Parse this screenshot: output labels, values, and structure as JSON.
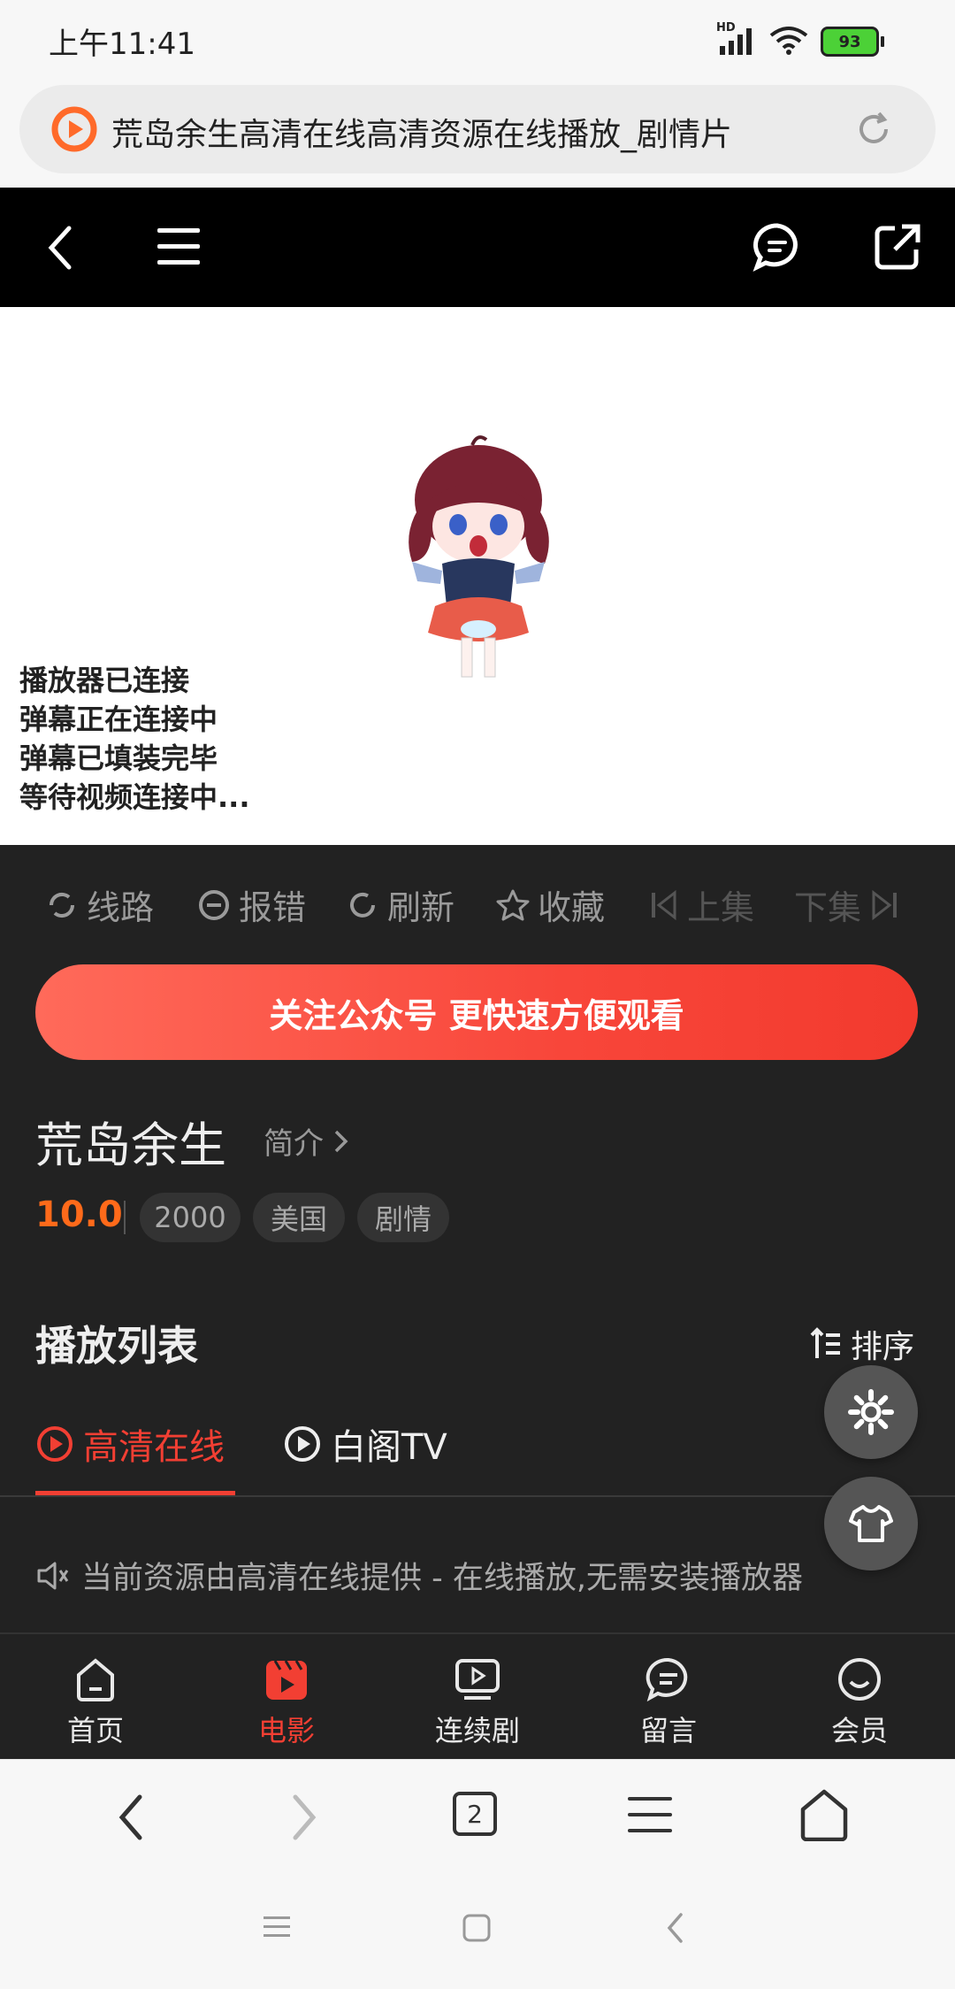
{
  "status_bar": {
    "time": "上午11:41",
    "network": "HD",
    "battery": "93"
  },
  "address_bar": {
    "title": "荒岛余生高清在线高清资源在线播放_剧情片"
  },
  "player": {
    "logs": [
      "播放器已连接",
      "弹幕正在连接中",
      "弹幕已填装完毕",
      "等待视频连接中..."
    ]
  },
  "toolbar": {
    "route": "线路",
    "report": "报错",
    "refresh": "刷新",
    "favorite": "收藏",
    "prev": "上集",
    "next": "下集"
  },
  "follow_banner": "关注公众号 更快速方便观看",
  "movie": {
    "title": "荒岛余生",
    "intro_link": "简介",
    "score": "10.0",
    "tags": [
      "2000",
      "美国",
      "剧情"
    ]
  },
  "playlist": {
    "heading": "播放列表",
    "sort_label": "排序",
    "tabs": [
      "高清在线",
      "白阁TV"
    ],
    "notice": "当前资源由高清在线提供 - 在线播放,无需安装播放器"
  },
  "bottom_nav": {
    "items": [
      "首页",
      "电影",
      "连续剧",
      "留言",
      "会员"
    ],
    "active_index": 1
  },
  "browser_bar": {
    "tab_count": "2"
  },
  "colors": {
    "accent": "#f23f33",
    "score": "#ff6a1a",
    "dark_bg": "#222222"
  }
}
